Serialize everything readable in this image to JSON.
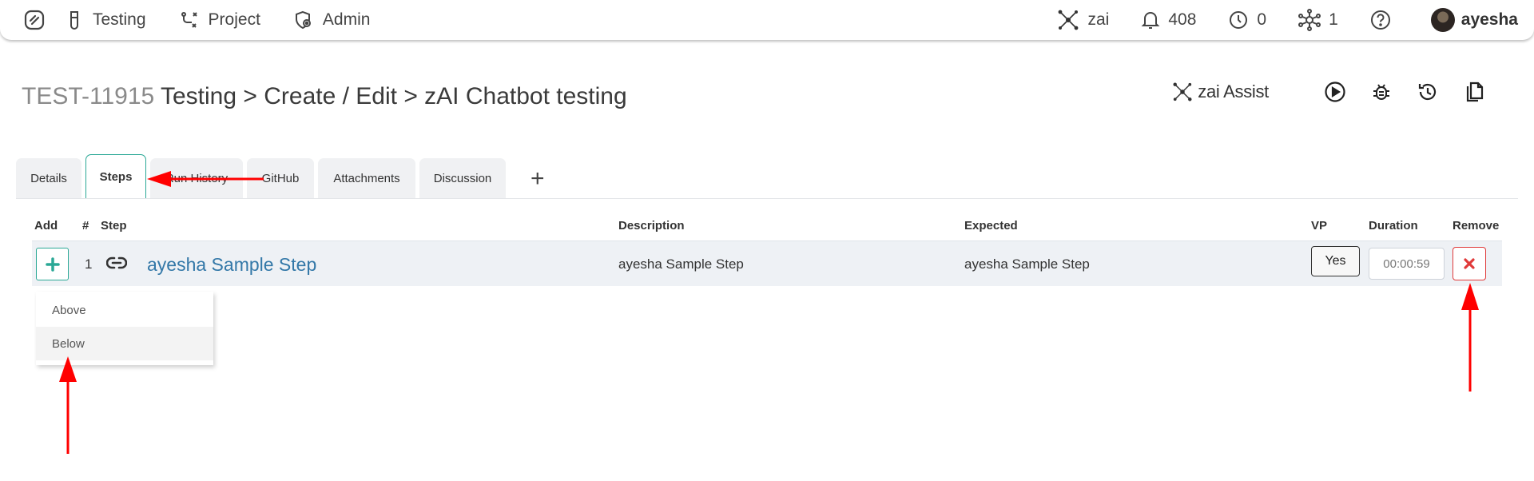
{
  "nav": {
    "items": [
      {
        "name": "testing",
        "label": "Testing"
      },
      {
        "name": "project",
        "label": "Project"
      },
      {
        "name": "admin",
        "label": "Admin"
      }
    ],
    "zai_label": "zai",
    "notifications_count": "408",
    "timer_count": "0",
    "network_count": "1",
    "username": "ayesha"
  },
  "page": {
    "key": "TEST-11915",
    "breadcrumb": "Testing > Create / Edit > zAI Chatbot testing",
    "assist_label": "zai Assist"
  },
  "tabs": [
    {
      "label": "Details",
      "active": false
    },
    {
      "label": "Steps",
      "active": true
    },
    {
      "label": "Run History",
      "active": false
    },
    {
      "label": "GitHub",
      "active": false
    },
    {
      "label": "Attachments",
      "active": false
    },
    {
      "label": "Discussion",
      "active": false
    }
  ],
  "tab_add_label": "+",
  "table": {
    "headers": {
      "add": "Add",
      "num": "#",
      "step": "Step",
      "description": "Description",
      "expected": "Expected",
      "vp": "VP",
      "duration": "Duration",
      "remove": "Remove"
    },
    "rows": [
      {
        "num": "1",
        "step": "ayesha Sample Step",
        "description": "ayesha Sample Step",
        "expected": "ayesha Sample Step",
        "vp": "Yes",
        "duration": "00:00:59"
      }
    ]
  },
  "add_menu": {
    "options": [
      "Above",
      "Below"
    ],
    "hovered": "Below"
  },
  "colors": {
    "accent": "#2ba896",
    "link": "#3378a8",
    "danger": "#e03a3a",
    "annotation": "#ff0000"
  }
}
